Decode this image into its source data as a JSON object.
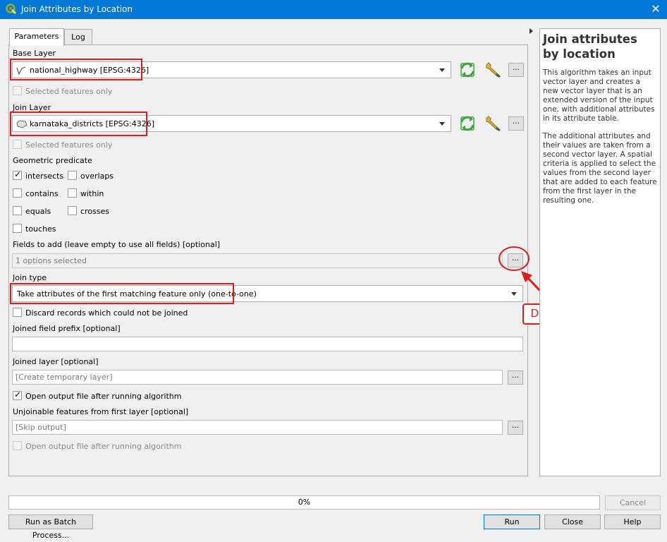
{
  "window": {
    "title": "Join Attributes by Location",
    "close_glyph": "✕"
  },
  "tabs": [
    {
      "label": "Parameters"
    },
    {
      "label": "Log"
    }
  ],
  "base_layer": {
    "label": "Base Layer",
    "value": "national_highway [EPSG:4326]",
    "selected_only": "Selected features only"
  },
  "join_layer": {
    "label": "Join Layer",
    "value": "karnataka_districts [EPSG:4326]",
    "selected_only": "Selected features only"
  },
  "predicate": {
    "label": "Geometric predicate",
    "options": [
      {
        "label": "intersects",
        "checked": true
      },
      {
        "label": "overlaps",
        "checked": false
      },
      {
        "label": "contains",
        "checked": false
      },
      {
        "label": "within",
        "checked": false
      },
      {
        "label": "equals",
        "checked": false
      },
      {
        "label": "crosses",
        "checked": false
      },
      {
        "label": "touches",
        "checked": false
      }
    ]
  },
  "fields_to_add": {
    "label": "Fields to add (leave empty to use all fields) [optional]",
    "value": "1 options selected"
  },
  "join_type": {
    "label": "Join type",
    "value": "Take attributes of the first matching feature only (one-to-one)"
  },
  "discard": {
    "label": "Discard records which could not be joined"
  },
  "prefix": {
    "label": "Joined field prefix [optional]",
    "value": ""
  },
  "joined_layer": {
    "label": "Joined layer [optional]",
    "placeholder": "[Create temporary layer]",
    "open_after": "Open output file after running algorithm"
  },
  "unjoinable": {
    "label": "Unjoinable features from first layer [optional]",
    "placeholder": "[Skip output]",
    "open_after": "Open output file after running algorithm"
  },
  "browse_glyph": "…",
  "check_glyph": "✓",
  "annotation": {
    "text": "DISTRICT",
    "color": "#e11a1a"
  },
  "help": {
    "title": "Join attributes by location",
    "paragraphs": [
      "This algorithm takes an input vector layer and creates a new vector layer that is an extended version of the input one, with additional attributes in its attribute table.",
      "The additional attributes and their values are taken from a second vector layer. A spatial criteria is applied to select the values from the second layer that are added to each feature from the first layer in the resulting one."
    ]
  },
  "progress": {
    "text": "0%",
    "value": 0
  },
  "buttons": {
    "cancel": "Cancel",
    "batch": "Run as Batch Process...",
    "run": "Run",
    "close": "Close",
    "help": "Help"
  },
  "colors": {
    "titlebar": "#0078d7",
    "highlight": "#e11a1a",
    "refresh_icon": "#3aa53a"
  }
}
